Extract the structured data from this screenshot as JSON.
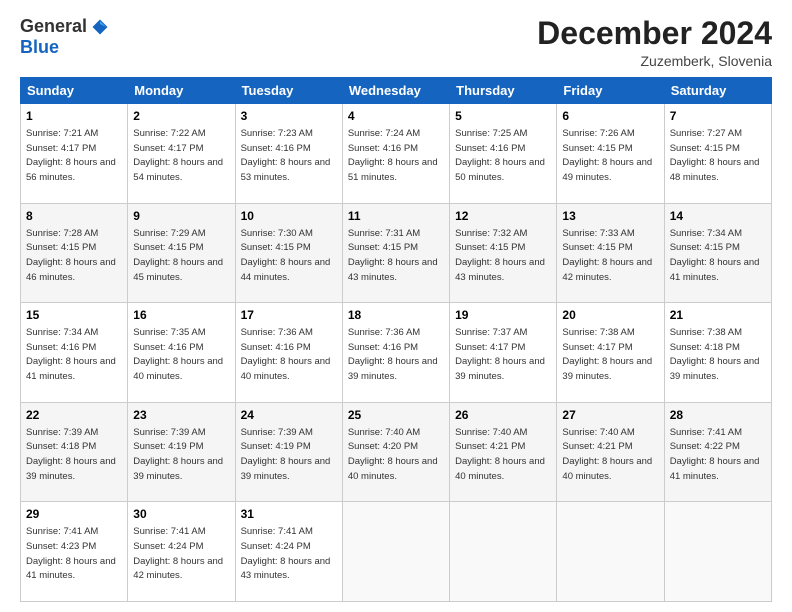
{
  "header": {
    "logo_general": "General",
    "logo_blue": "Blue",
    "month": "December 2024",
    "location": "Zuzemberk, Slovenia"
  },
  "days_of_week": [
    "Sunday",
    "Monday",
    "Tuesday",
    "Wednesday",
    "Thursday",
    "Friday",
    "Saturday"
  ],
  "weeks": [
    [
      {
        "day": "1",
        "sunrise": "Sunrise: 7:21 AM",
        "sunset": "Sunset: 4:17 PM",
        "daylight": "Daylight: 8 hours and 56 minutes."
      },
      {
        "day": "2",
        "sunrise": "Sunrise: 7:22 AM",
        "sunset": "Sunset: 4:17 PM",
        "daylight": "Daylight: 8 hours and 54 minutes."
      },
      {
        "day": "3",
        "sunrise": "Sunrise: 7:23 AM",
        "sunset": "Sunset: 4:16 PM",
        "daylight": "Daylight: 8 hours and 53 minutes."
      },
      {
        "day": "4",
        "sunrise": "Sunrise: 7:24 AM",
        "sunset": "Sunset: 4:16 PM",
        "daylight": "Daylight: 8 hours and 51 minutes."
      },
      {
        "day": "5",
        "sunrise": "Sunrise: 7:25 AM",
        "sunset": "Sunset: 4:16 PM",
        "daylight": "Daylight: 8 hours and 50 minutes."
      },
      {
        "day": "6",
        "sunrise": "Sunrise: 7:26 AM",
        "sunset": "Sunset: 4:15 PM",
        "daylight": "Daylight: 8 hours and 49 minutes."
      },
      {
        "day": "7",
        "sunrise": "Sunrise: 7:27 AM",
        "sunset": "Sunset: 4:15 PM",
        "daylight": "Daylight: 8 hours and 48 minutes."
      }
    ],
    [
      {
        "day": "8",
        "sunrise": "Sunrise: 7:28 AM",
        "sunset": "Sunset: 4:15 PM",
        "daylight": "Daylight: 8 hours and 46 minutes."
      },
      {
        "day": "9",
        "sunrise": "Sunrise: 7:29 AM",
        "sunset": "Sunset: 4:15 PM",
        "daylight": "Daylight: 8 hours and 45 minutes."
      },
      {
        "day": "10",
        "sunrise": "Sunrise: 7:30 AM",
        "sunset": "Sunset: 4:15 PM",
        "daylight": "Daylight: 8 hours and 44 minutes."
      },
      {
        "day": "11",
        "sunrise": "Sunrise: 7:31 AM",
        "sunset": "Sunset: 4:15 PM",
        "daylight": "Daylight: 8 hours and 43 minutes."
      },
      {
        "day": "12",
        "sunrise": "Sunrise: 7:32 AM",
        "sunset": "Sunset: 4:15 PM",
        "daylight": "Daylight: 8 hours and 43 minutes."
      },
      {
        "day": "13",
        "sunrise": "Sunrise: 7:33 AM",
        "sunset": "Sunset: 4:15 PM",
        "daylight": "Daylight: 8 hours and 42 minutes."
      },
      {
        "day": "14",
        "sunrise": "Sunrise: 7:34 AM",
        "sunset": "Sunset: 4:15 PM",
        "daylight": "Daylight: 8 hours and 41 minutes."
      }
    ],
    [
      {
        "day": "15",
        "sunrise": "Sunrise: 7:34 AM",
        "sunset": "Sunset: 4:16 PM",
        "daylight": "Daylight: 8 hours and 41 minutes."
      },
      {
        "day": "16",
        "sunrise": "Sunrise: 7:35 AM",
        "sunset": "Sunset: 4:16 PM",
        "daylight": "Daylight: 8 hours and 40 minutes."
      },
      {
        "day": "17",
        "sunrise": "Sunrise: 7:36 AM",
        "sunset": "Sunset: 4:16 PM",
        "daylight": "Daylight: 8 hours and 40 minutes."
      },
      {
        "day": "18",
        "sunrise": "Sunrise: 7:36 AM",
        "sunset": "Sunset: 4:16 PM",
        "daylight": "Daylight: 8 hours and 39 minutes."
      },
      {
        "day": "19",
        "sunrise": "Sunrise: 7:37 AM",
        "sunset": "Sunset: 4:17 PM",
        "daylight": "Daylight: 8 hours and 39 minutes."
      },
      {
        "day": "20",
        "sunrise": "Sunrise: 7:38 AM",
        "sunset": "Sunset: 4:17 PM",
        "daylight": "Daylight: 8 hours and 39 minutes."
      },
      {
        "day": "21",
        "sunrise": "Sunrise: 7:38 AM",
        "sunset": "Sunset: 4:18 PM",
        "daylight": "Daylight: 8 hours and 39 minutes."
      }
    ],
    [
      {
        "day": "22",
        "sunrise": "Sunrise: 7:39 AM",
        "sunset": "Sunset: 4:18 PM",
        "daylight": "Daylight: 8 hours and 39 minutes."
      },
      {
        "day": "23",
        "sunrise": "Sunrise: 7:39 AM",
        "sunset": "Sunset: 4:19 PM",
        "daylight": "Daylight: 8 hours and 39 minutes."
      },
      {
        "day": "24",
        "sunrise": "Sunrise: 7:39 AM",
        "sunset": "Sunset: 4:19 PM",
        "daylight": "Daylight: 8 hours and 39 minutes."
      },
      {
        "day": "25",
        "sunrise": "Sunrise: 7:40 AM",
        "sunset": "Sunset: 4:20 PM",
        "daylight": "Daylight: 8 hours and 40 minutes."
      },
      {
        "day": "26",
        "sunrise": "Sunrise: 7:40 AM",
        "sunset": "Sunset: 4:21 PM",
        "daylight": "Daylight: 8 hours and 40 minutes."
      },
      {
        "day": "27",
        "sunrise": "Sunrise: 7:40 AM",
        "sunset": "Sunset: 4:21 PM",
        "daylight": "Daylight: 8 hours and 40 minutes."
      },
      {
        "day": "28",
        "sunrise": "Sunrise: 7:41 AM",
        "sunset": "Sunset: 4:22 PM",
        "daylight": "Daylight: 8 hours and 41 minutes."
      }
    ],
    [
      {
        "day": "29",
        "sunrise": "Sunrise: 7:41 AM",
        "sunset": "Sunset: 4:23 PM",
        "daylight": "Daylight: 8 hours and 41 minutes."
      },
      {
        "day": "30",
        "sunrise": "Sunrise: 7:41 AM",
        "sunset": "Sunset: 4:24 PM",
        "daylight": "Daylight: 8 hours and 42 minutes."
      },
      {
        "day": "31",
        "sunrise": "Sunrise: 7:41 AM",
        "sunset": "Sunset: 4:24 PM",
        "daylight": "Daylight: 8 hours and 43 minutes."
      },
      null,
      null,
      null,
      null
    ]
  ]
}
